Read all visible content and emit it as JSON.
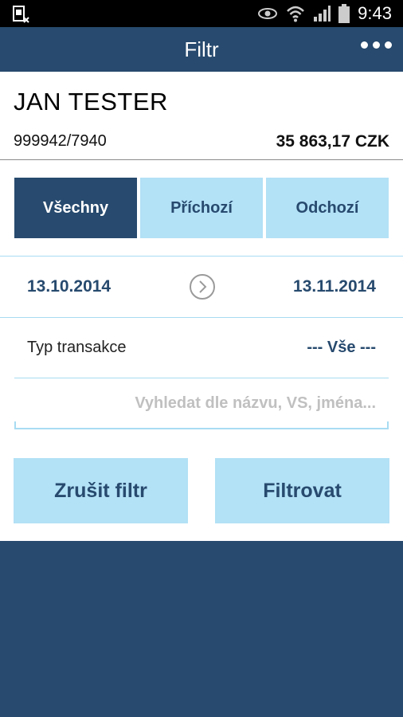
{
  "status_bar": {
    "time": "9:43",
    "icons": [
      "sim-card-icon",
      "eye-icon",
      "wifi-icon",
      "signal-icon",
      "battery-icon"
    ]
  },
  "header": {
    "title": "Filtr",
    "menu_icon": "overflow-menu-icon"
  },
  "account": {
    "name": "JAN TESTER",
    "number": "999942/7940",
    "balance": "35 863,17 CZK"
  },
  "segments": [
    {
      "label": "Všechny",
      "active": true
    },
    {
      "label": "Příchozí",
      "active": false
    },
    {
      "label": "Odchozí",
      "active": false
    }
  ],
  "date_range": {
    "from": "13.10.2014",
    "to": "13.11.2014",
    "arrow_icon": "chevron-right-circle-icon"
  },
  "transaction_type": {
    "label": "Typ transakce",
    "value": "--- Vše ---"
  },
  "search": {
    "placeholder": "Vyhledat dle názvu, VS, jména...",
    "value": ""
  },
  "actions": {
    "cancel_label": "Zrušit filtr",
    "submit_label": "Filtrovat"
  },
  "colors": {
    "primary": "#274a6e",
    "accent_light": "#b3e1f6",
    "status_bar": "#000000"
  }
}
